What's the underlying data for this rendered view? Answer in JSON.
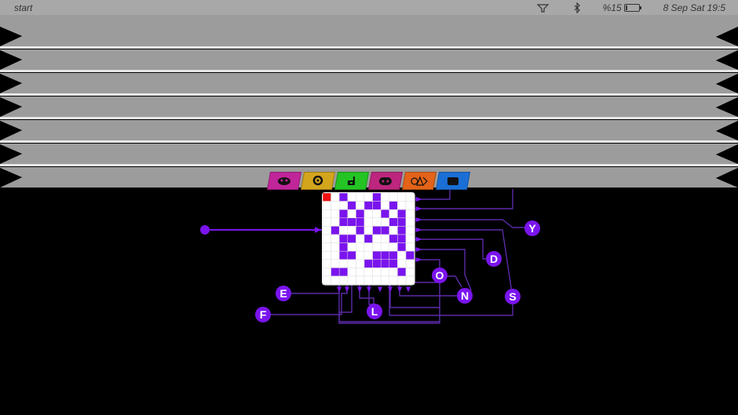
{
  "status_bar": {
    "app_name": "start",
    "battery_text": "%15",
    "battery_level": 0.15,
    "datetime": "8 Sep Sat 19:5",
    "icons": [
      "mailbox-icon",
      "bluetooth-icon",
      "battery-icon"
    ]
  },
  "colors": {
    "accent": "#7a14ee",
    "wire": "#5a2aa8",
    "blind": "#9c9c9c",
    "blind_highlight": "#ffffff",
    "board": "#ffffff",
    "start_cell": "#ee1111"
  },
  "category_tabs": [
    {
      "name": "mask",
      "color": "#c0259a",
      "icon": "mask-icon"
    },
    {
      "name": "ring",
      "color": "#d3a51c",
      "icon": "ring-icon"
    },
    {
      "name": "music",
      "color": "#24c424",
      "icon": "music-note-icon"
    },
    {
      "name": "dots",
      "color": "#bd267e",
      "icon": "dots-icon"
    },
    {
      "name": "shapes",
      "color": "#e36318",
      "icon": "shapes-icon"
    },
    {
      "name": "card",
      "color": "#1a6fd6",
      "icon": "card-icon"
    }
  ],
  "grid": {
    "rows": 11,
    "cols": 11,
    "start_cell": [
      0,
      0
    ],
    "cells": [
      "00100010000",
      "00010110100",
      "00101001010",
      "00111000110",
      "01001011010",
      "00110100110",
      "00100000010",
      "00110011101",
      "00000111100",
      "01100000010",
      "00000000000"
    ]
  },
  "letter_nodes": [
    {
      "letter": "Y"
    },
    {
      "letter": "D"
    },
    {
      "letter": "O"
    },
    {
      "letter": "N"
    },
    {
      "letter": "S"
    },
    {
      "letter": "E"
    },
    {
      "letter": "F"
    },
    {
      "letter": "L"
    }
  ]
}
